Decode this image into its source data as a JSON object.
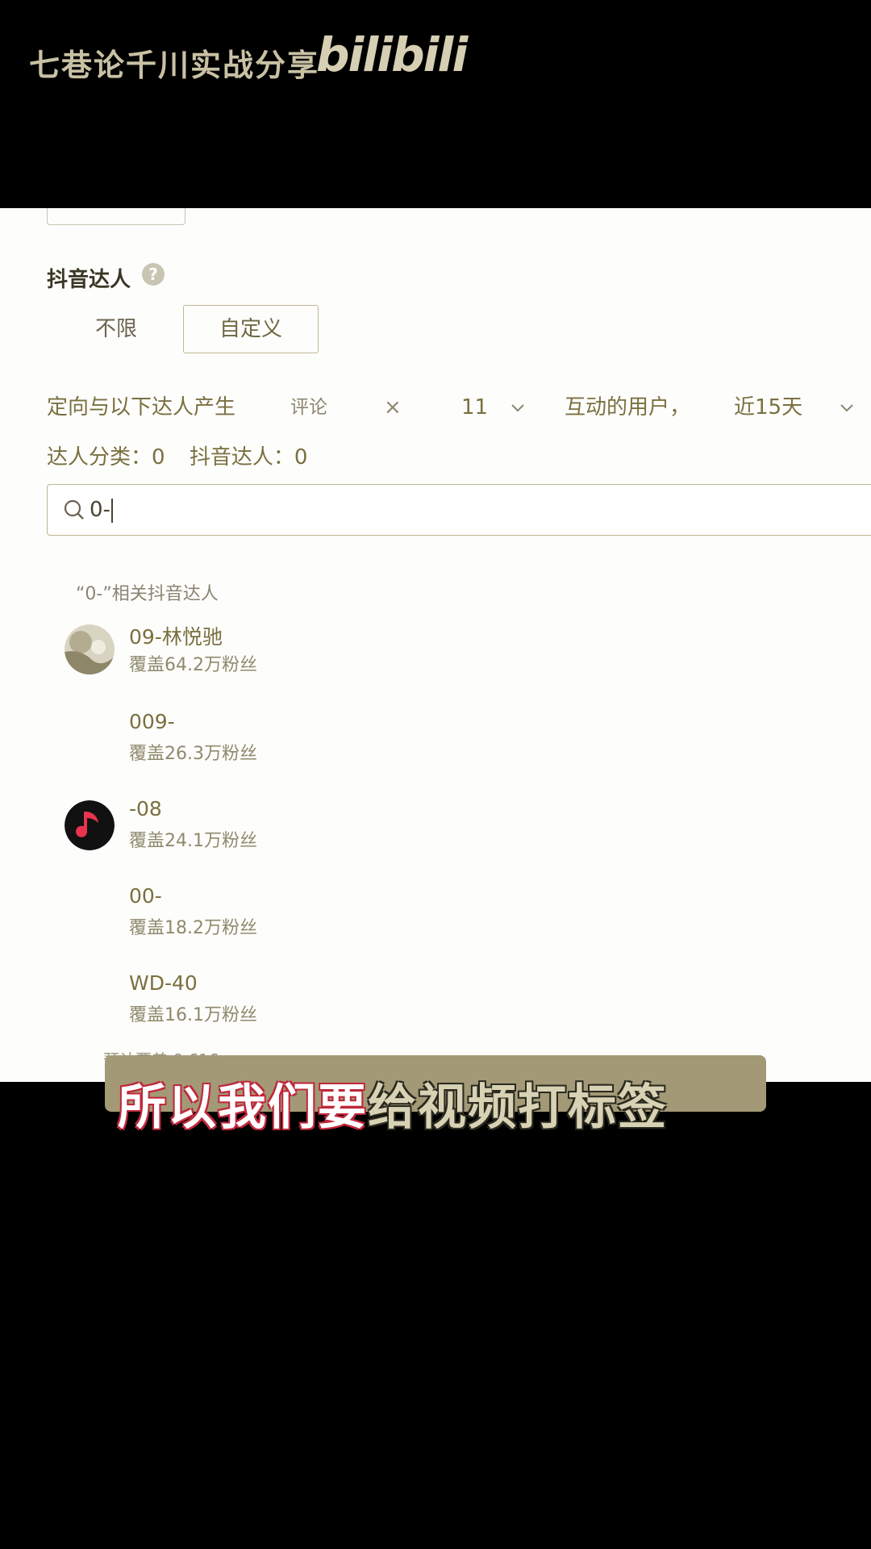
{
  "header": {
    "channel_name": "七巷论千川实战分享",
    "platform_logo": "bilibili"
  },
  "form": {
    "section_title": "抖音达人",
    "help_icon": "question-icon",
    "options": [
      "不限",
      "自定义"
    ],
    "selected_option": "自定义",
    "targeting": {
      "description": "定向与以下达人产生",
      "action": "评论",
      "remove_symbol": "×",
      "count": "11",
      "interaction": "互动的用户，",
      "time_range": "近15天"
    },
    "stats": {
      "category": "达人分类：0",
      "creators": "抖音达人：0"
    },
    "search": {
      "value": "0-"
    },
    "suggest_header": "“0-”相关抖音达人",
    "results": [
      {
        "name": "09-林悦驰",
        "fans": "覆盖64.2万粉丝",
        "avatar": "photo"
      },
      {
        "name": "009-",
        "fans": "覆盖26.3万粉丝",
        "avatar": "none"
      },
      {
        "name": "-08",
        "fans": "覆盖24.1万粉丝",
        "avatar": "music-note"
      },
      {
        "name": "00-",
        "fans": "覆盖18.2万粉丝",
        "avatar": "none"
      },
      {
        "name": "WD-40",
        "fans": "覆盖16.1万粉丝",
        "avatar": "none"
      }
    ],
    "partial_text": "预计覆盖 0.616"
  },
  "subtitle": {
    "part1": "所以我们要",
    "part2": "给视频打标签"
  },
  "colors": {
    "accent_text": "#7a7040",
    "caption_red": "#c0283c",
    "caption_bg": "#a39976"
  }
}
